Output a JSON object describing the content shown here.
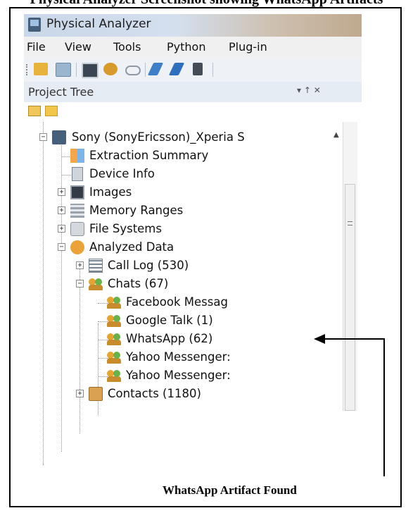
{
  "figure_caption": "Physical Analyzer Screenshot showing WhatsApp Artifacts",
  "window": {
    "title": "Physical Analyzer"
  },
  "menu": [
    "File",
    "View",
    "Tools",
    "Python",
    "Plug-in"
  ],
  "toolbar_icons": [
    "open-folder-icon",
    "open-image-icon",
    "terminal-icon",
    "package-icon",
    "chain-link-icon",
    "attach-icon",
    "pen-icon",
    "device-icon"
  ],
  "panel": {
    "title": "Project Tree",
    "controls": "▾ ↑ ✕"
  },
  "tree": {
    "root": "Sony (SonyEricsson)_Xperia S",
    "items": [
      {
        "label": "Extraction Summary"
      },
      {
        "label": "Device Info"
      },
      {
        "label": "Images"
      },
      {
        "label": "Memory Ranges"
      },
      {
        "label": "File Systems"
      },
      {
        "label": "Analyzed Data"
      },
      {
        "label": "Call Log (530)"
      },
      {
        "label": "Chats (67)"
      },
      {
        "label": "Facebook Messag"
      },
      {
        "label": "Google Talk (1)"
      },
      {
        "label": "WhatsApp (62)"
      },
      {
        "label": "Yahoo Messenger:"
      },
      {
        "label": "Yahoo Messenger:"
      },
      {
        "label": "Contacts (1180)"
      }
    ]
  },
  "annotation": "WhatsApp Artifact Found",
  "colors": {
    "titlebar": "#c9d7ea",
    "menubar": "#f0f0f0",
    "panelbar": "#e6ecf4"
  }
}
